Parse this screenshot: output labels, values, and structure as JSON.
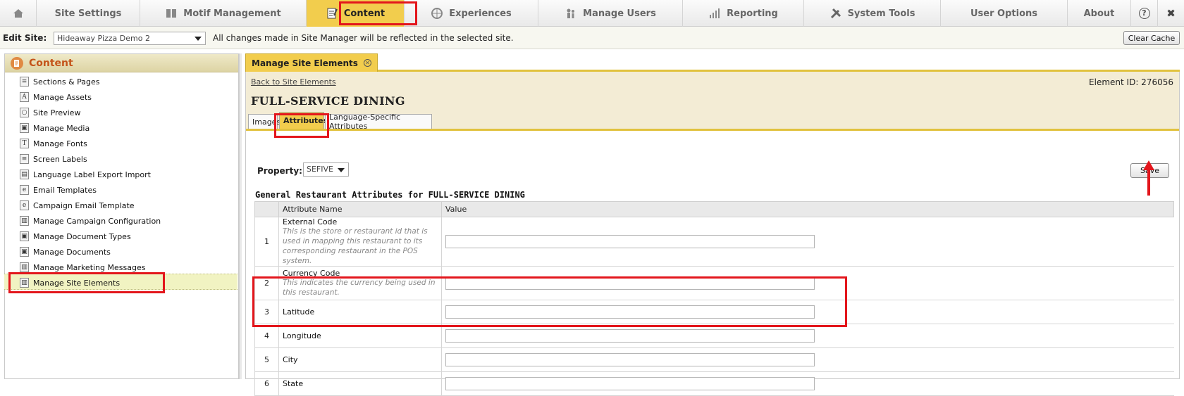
{
  "nav": {
    "items": [
      {
        "label": "",
        "icon": "home-icon"
      },
      {
        "label": "Site Settings",
        "icon": ""
      },
      {
        "label": "Motif Management",
        "icon": "book-icon"
      },
      {
        "label": "Content",
        "icon": "content-icon"
      },
      {
        "label": "Experiences",
        "icon": "globe-icon"
      },
      {
        "label": "Manage Users",
        "icon": "users-icon"
      },
      {
        "label": "Reporting",
        "icon": "bar-chart-icon"
      },
      {
        "label": "System Tools",
        "icon": "tools-icon"
      },
      {
        "label": "User Options",
        "icon": ""
      },
      {
        "label": "About",
        "icon": ""
      }
    ],
    "help_icon": "?",
    "close_icon": "✖"
  },
  "editbar": {
    "label": "Edit Site:",
    "site_value": "Hideaway Pizza Demo 2",
    "message": "All changes made in Site Manager will be reflected in the selected site.",
    "clear_cache": "Clear Cache"
  },
  "sidebar": {
    "title": "Content",
    "items": [
      {
        "label": "Sections & Pages",
        "icon": "page-icon"
      },
      {
        "label": "Manage Assets",
        "icon": "font-a-icon"
      },
      {
        "label": "Site Preview",
        "icon": "magnifier-icon"
      },
      {
        "label": "Manage Media",
        "icon": "media-icon"
      },
      {
        "label": "Manage Fonts",
        "icon": "font-t-icon"
      },
      {
        "label": "Screen Labels",
        "icon": "page-icon"
      },
      {
        "label": "Language Label Export Import",
        "icon": "table-icon"
      },
      {
        "label": "Email Templates",
        "icon": "email-icon"
      },
      {
        "label": "Campaign Email Template",
        "icon": "email-icon"
      },
      {
        "label": "Manage Campaign Configuration",
        "icon": "clipboard-icon"
      },
      {
        "label": "Manage Document Types",
        "icon": "media-icon"
      },
      {
        "label": "Manage Documents",
        "icon": "media-icon"
      },
      {
        "label": "Manage Marketing Messages",
        "icon": "clipboard-icon"
      },
      {
        "label": "Manage Site Elements",
        "icon": "clipboard-icon"
      }
    ]
  },
  "main": {
    "tab_label": "Manage Site Elements",
    "back_link": "Back to Site Elements",
    "element_id": "Element ID: 276056",
    "element_title": "FULL-SERVICE DINING",
    "subtabs": [
      "Images",
      "Attributes",
      "Language-Specific Attributes"
    ],
    "property_label": "Property:",
    "property_value": "SEFIVE",
    "save_label": "Save",
    "section_title": "General Restaurant Attributes for FULL-SERVICE DINING",
    "columns": [
      "",
      "Attribute Name",
      "Value"
    ],
    "rows": [
      {
        "num": "1",
        "name": "External Code",
        "desc": "This is the store or restaurant id that is used in mapping this restaurant to its corresponding restaurant in the POS system.",
        "value": ""
      },
      {
        "num": "2",
        "name": "Currency Code",
        "desc": "This indicates the currency being used in this restaurant.",
        "value": ""
      },
      {
        "num": "3",
        "name": "Latitude",
        "desc": "",
        "value": ""
      },
      {
        "num": "4",
        "name": "Longitude",
        "desc": "",
        "value": ""
      },
      {
        "num": "5",
        "name": "City",
        "desc": "",
        "value": ""
      },
      {
        "num": "6",
        "name": "State",
        "desc": "",
        "value": ""
      }
    ]
  },
  "colors": {
    "accent": "#f2cd4d",
    "highlight": "#e3161c",
    "header_bg": "#f3ecd5",
    "sidebar_title": "#c4541a"
  }
}
